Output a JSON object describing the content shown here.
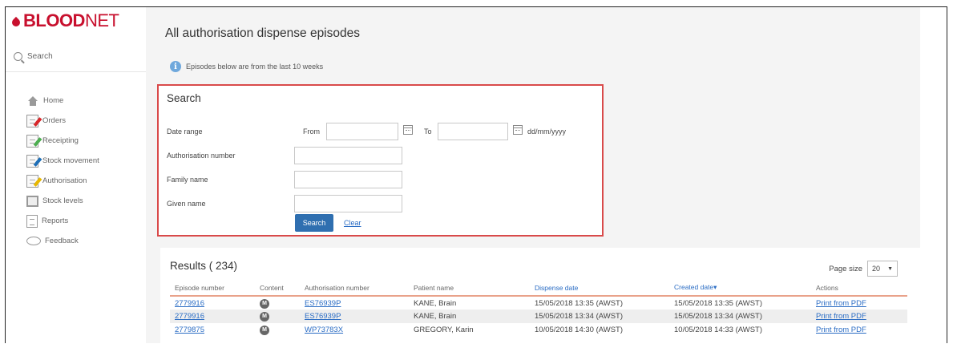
{
  "brand": {
    "logo_part1": "BLOOD",
    "logo_part2": "NET"
  },
  "sidebar": {
    "search_label": "Search",
    "items": [
      {
        "label": "Home",
        "icon": "home-icon"
      },
      {
        "label": "Orders",
        "icon": "orders-icon"
      },
      {
        "label": "Receipting",
        "icon": "receipting-icon"
      },
      {
        "label": "Stock movement",
        "icon": "stock-movement-icon"
      },
      {
        "label": "Authorisation",
        "icon": "authorisation-icon"
      },
      {
        "label": "Stock levels",
        "icon": "stock-levels-icon"
      },
      {
        "label": "Reports",
        "icon": "reports-icon"
      },
      {
        "label": "Feedback",
        "icon": "feedback-icon"
      }
    ]
  },
  "main": {
    "title": "All authorisation dispense episodes",
    "info_text": "Episodes below are from the last 10 weeks"
  },
  "search": {
    "heading": "Search",
    "date_range_label": "Date range",
    "from_label": "From",
    "to_label": "To",
    "date_format_hint": "dd/mm/yyyy",
    "authorisation_label": "Authorisation number",
    "family_name_label": "Family name",
    "given_name_label": "Given name",
    "search_button": "Search",
    "clear_link": "Clear"
  },
  "results": {
    "heading": "Results ( 234)",
    "page_size_label": "Page size",
    "page_size_value": "20",
    "columns": [
      "Episode number",
      "Content",
      "Authorisation number",
      "Patient name",
      "Dispense date",
      "Created date▾",
      "Actions"
    ],
    "rows": [
      {
        "episode": "2779916",
        "content": "M",
        "auth": "ES76939P",
        "patient": "KANE, Brain",
        "dispense": "15/05/2018 13:35 (AWST)",
        "created": "15/05/2018 13:35 (AWST)",
        "action": "Print from PDF"
      },
      {
        "episode": "2779916",
        "content": "M",
        "auth": "ES76939P",
        "patient": "KANE, Brain",
        "dispense": "15/05/2018 13:34 (AWST)",
        "created": "15/05/2018 13:34 (AWST)",
        "action": "Print from PDF"
      },
      {
        "episode": "2779875",
        "content": "M",
        "auth": "WP73783X",
        "patient": "GREGORY, Karin",
        "dispense": "10/05/2018 14:30 (AWST)",
        "created": "10/05/2018 14:33 (AWST)",
        "action": "Print from PDF"
      }
    ]
  },
  "colors": {
    "brand_red": "#c8102e",
    "highlight_border": "#d94a4a",
    "primary_button": "#2f6fb0",
    "link": "#2a6cc4"
  }
}
